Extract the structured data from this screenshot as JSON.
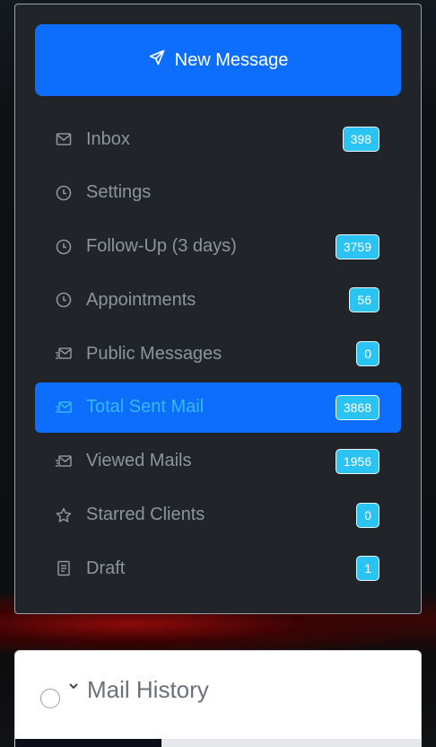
{
  "compose": {
    "label": "New Message",
    "icon": "send-icon"
  },
  "menu": [
    {
      "id": "inbox",
      "label": "Inbox",
      "icon": "envelope-icon",
      "badge": "398",
      "active": false
    },
    {
      "id": "settings",
      "label": "Settings",
      "icon": "clock-icon",
      "badge": "",
      "active": false
    },
    {
      "id": "follow-up",
      "label": "Follow-Up (3 days)",
      "icon": "clock-icon",
      "badge": "3759",
      "active": false
    },
    {
      "id": "appointments",
      "label": "Appointments",
      "icon": "clock-icon",
      "badge": "56",
      "active": false
    },
    {
      "id": "public-messages",
      "label": "Public Messages",
      "icon": "sent-mail-icon",
      "badge": "0",
      "active": false
    },
    {
      "id": "total-sent-mail",
      "label": "Total Sent Mail",
      "icon": "sent-mail-icon",
      "badge": "3868",
      "active": true
    },
    {
      "id": "viewed-mails",
      "label": "Viewed Mails",
      "icon": "sent-mail-icon",
      "badge": "1956",
      "active": false
    },
    {
      "id": "starred-clients",
      "label": "Starred Clients",
      "icon": "star-icon",
      "badge": "0",
      "active": false
    },
    {
      "id": "draft",
      "label": "Draft",
      "icon": "document-icon",
      "badge": "1",
      "active": false
    }
  ],
  "history": {
    "title": "Mail History",
    "progress": 0.36
  },
  "colors": {
    "accent": "#0d6efd",
    "badge": "#2bc4f2",
    "panel": "#212529"
  }
}
